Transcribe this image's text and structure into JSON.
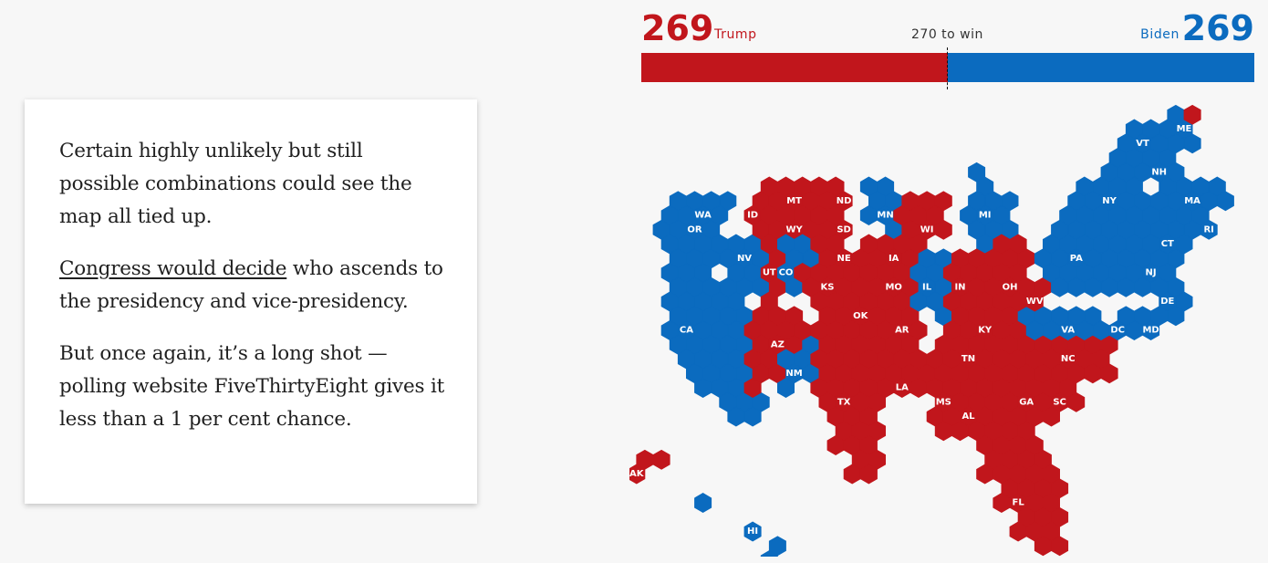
{
  "article": {
    "p1": "Certain highly unlikely but still possible combinations could see the map all tied up.",
    "p2_link": "Congress would decide",
    "p2_rest": " who ascends to the presidency and vice-presidency.",
    "p3": "But once again, it’s a long shot — polling website FiveThirtyEight gives it less than a 1 per cent chance."
  },
  "tally": {
    "rep_votes": "269",
    "rep_name": "Trump",
    "dem_votes": "269",
    "dem_name": "Biden",
    "threshold": "270 to win",
    "rep_share": 0.5
  },
  "colors": {
    "rep": "#c1161c",
    "dem": "#0b6bbf"
  },
  "map": {
    "states": [
      {
        "abbr": "WA",
        "party": "dem"
      },
      {
        "abbr": "OR",
        "party": "dem"
      },
      {
        "abbr": "CA",
        "party": "dem"
      },
      {
        "abbr": "NV",
        "party": "dem"
      },
      {
        "abbr": "ID",
        "party": "rep"
      },
      {
        "abbr": "MT",
        "party": "rep"
      },
      {
        "abbr": "WY",
        "party": "rep"
      },
      {
        "abbr": "UT",
        "party": "rep"
      },
      {
        "abbr": "CO",
        "party": "dem"
      },
      {
        "abbr": "AZ",
        "party": "rep"
      },
      {
        "abbr": "NM",
        "party": "dem"
      },
      {
        "abbr": "ND",
        "party": "rep"
      },
      {
        "abbr": "SD",
        "party": "rep"
      },
      {
        "abbr": "NE",
        "party": "rep"
      },
      {
        "abbr": "KS",
        "party": "rep"
      },
      {
        "abbr": "OK",
        "party": "rep"
      },
      {
        "abbr": "TX",
        "party": "rep"
      },
      {
        "abbr": "MN",
        "party": "dem"
      },
      {
        "abbr": "IA",
        "party": "rep"
      },
      {
        "abbr": "MO",
        "party": "rep"
      },
      {
        "abbr": "AR",
        "party": "rep"
      },
      {
        "abbr": "LA",
        "party": "rep"
      },
      {
        "abbr": "WI",
        "party": "rep"
      },
      {
        "abbr": "IL",
        "party": "dem"
      },
      {
        "abbr": "MI",
        "party": "dem"
      },
      {
        "abbr": "IN",
        "party": "rep"
      },
      {
        "abbr": "OH",
        "party": "rep"
      },
      {
        "abbr": "KY",
        "party": "rep"
      },
      {
        "abbr": "TN",
        "party": "rep"
      },
      {
        "abbr": "MS",
        "party": "rep"
      },
      {
        "abbr": "AL",
        "party": "rep"
      },
      {
        "abbr": "GA",
        "party": "rep"
      },
      {
        "abbr": "FL",
        "party": "rep"
      },
      {
        "abbr": "SC",
        "party": "rep"
      },
      {
        "abbr": "NC",
        "party": "rep"
      },
      {
        "abbr": "VA",
        "party": "dem"
      },
      {
        "abbr": "WV",
        "party": "rep"
      },
      {
        "abbr": "PA",
        "party": "dem"
      },
      {
        "abbr": "NY",
        "party": "dem"
      },
      {
        "abbr": "NJ",
        "party": "dem"
      },
      {
        "abbr": "DE",
        "party": "dem"
      },
      {
        "abbr": "MD",
        "party": "dem"
      },
      {
        "abbr": "DC",
        "party": "dem"
      },
      {
        "abbr": "CT",
        "party": "dem"
      },
      {
        "abbr": "RI",
        "party": "dem"
      },
      {
        "abbr": "MA",
        "party": "dem"
      },
      {
        "abbr": "VT",
        "party": "dem"
      },
      {
        "abbr": "NH",
        "party": "dem"
      },
      {
        "abbr": "ME",
        "party": "dem"
      },
      {
        "abbr": "AK",
        "party": "rep"
      },
      {
        "abbr": "HI",
        "party": "dem"
      }
    ],
    "extra_cells": [
      {
        "label": "ME district",
        "party": "rep"
      }
    ]
  }
}
